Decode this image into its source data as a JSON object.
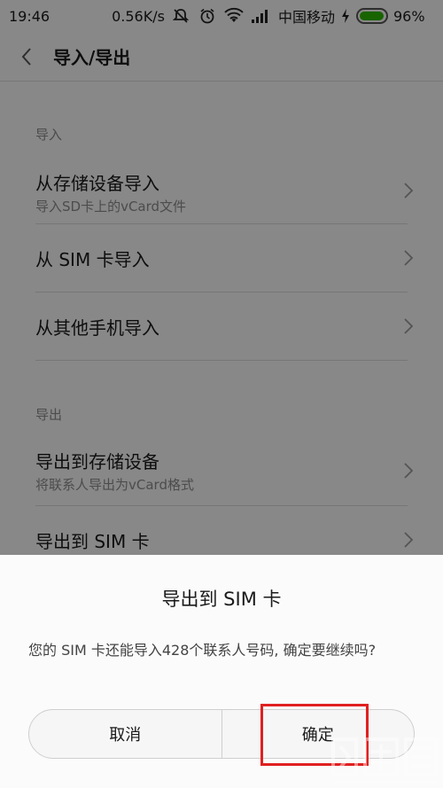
{
  "status_bar": {
    "time": "19:46",
    "net_speed": "0.56K/s",
    "carrier": "中国移动",
    "battery_percent": "96%",
    "battery_level": 0.96,
    "icons": [
      "mute-icon",
      "alarm-icon",
      "wifi-icon",
      "signal-icon",
      "charging-icon"
    ],
    "battery_color": "#2db600"
  },
  "header": {
    "title": "导入/导出"
  },
  "sections": [
    {
      "label": "导入",
      "items": [
        {
          "title": "从存储设备导入",
          "subtitle": "导入SD卡上的vCard文件"
        },
        {
          "title": "从 SIM 卡导入"
        },
        {
          "title": "从其他手机导入"
        }
      ]
    },
    {
      "label": "导出",
      "items": [
        {
          "title": "导出到存储设备",
          "subtitle": "将联系人导出为vCard格式"
        },
        {
          "title": "导出到 SIM 卡"
        }
      ]
    }
  ],
  "dialog": {
    "title": "导出到 SIM 卡",
    "message": "您的 SIM 卡还能导入428个联系人号码, 确定要继续吗?",
    "cancel_label": "取消",
    "confirm_label": "确定"
  },
  "colors": {
    "highlight": "#e02020",
    "overlay": "rgba(0,0,0,0.45)"
  }
}
